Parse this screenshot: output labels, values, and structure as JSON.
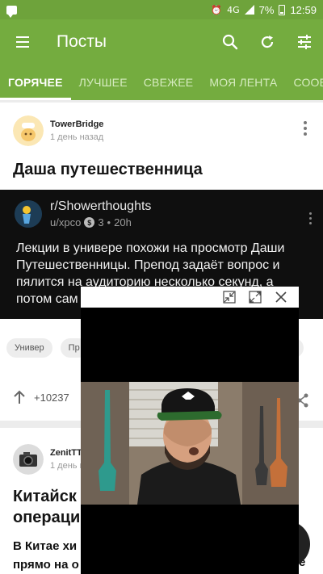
{
  "status_bar": {
    "signal_text": "4G",
    "battery": "7%",
    "time": "12:59"
  },
  "app_bar": {
    "title": "Посты",
    "icons": [
      "menu-icon",
      "search-icon",
      "refresh-icon",
      "filter-icon"
    ]
  },
  "tabs": [
    {
      "label": "ГОРЯЧЕЕ",
      "active": true
    },
    {
      "label": "ЛУЧШЕЕ",
      "active": false
    },
    {
      "label": "СВЕЖЕЕ",
      "active": false
    },
    {
      "label": "МОЯ ЛЕНТА",
      "active": false
    },
    {
      "label": "СООБ",
      "active": false
    }
  ],
  "posts": [
    {
      "author": "TowerBridge",
      "time": "1 день назад",
      "title": "Даша путешественница",
      "embed": {
        "subreddit": "r/Showerthoughts",
        "user": "u/xpco",
        "karma": "3",
        "age": "20h",
        "text": "Лекции в универе похожи на просмотр Даши Путешественницы. Препод задаёт вопрос и пялится на аудиторию несколько секунд, а потом сам"
      },
      "chips": [
        "Универ",
        "Пр"
      ],
      "score": "+10237"
    },
    {
      "author": "ZenitTT",
      "time": "1 день н",
      "title_line1": "Китайск",
      "title_line2": "операци",
      "body_line1": "В Китае хи",
      "body_line2": "прямо на о",
      "body_tail": "е"
    }
  ],
  "colors": {
    "app_bar": "#74ac3f",
    "status_bar": "#6ea33b",
    "embed_bg": "#0f0f0f"
  }
}
